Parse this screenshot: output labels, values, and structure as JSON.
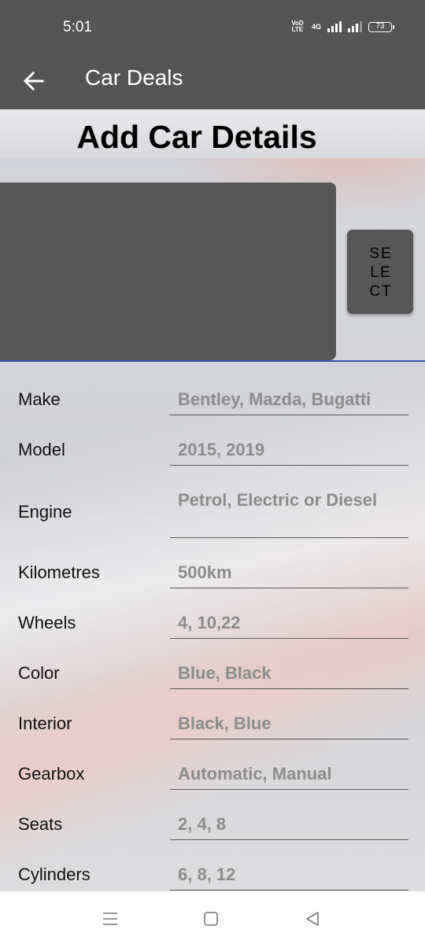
{
  "status_bar": {
    "time": "5:01",
    "volte_label": "VoD LTE",
    "network_label": "4G",
    "battery": "73"
  },
  "app_bar": {
    "title": "Car Deals",
    "back_icon": "arrow-left-icon"
  },
  "page": {
    "title": "Add Car Details",
    "select_button_label": "SELECT"
  },
  "form": {
    "fields": [
      {
        "label": "Make",
        "placeholder": "Bentley, Mazda, Bugatti"
      },
      {
        "label": "Model",
        "placeholder": "2015, 2019"
      },
      {
        "label": "Engine",
        "placeholder": "Petrol, Electric or Diesel"
      },
      {
        "label": "Kilometres",
        "placeholder": "500km"
      },
      {
        "label": "Wheels",
        "placeholder": "4, 10,22"
      },
      {
        "label": "Color",
        "placeholder": "Blue, Black"
      },
      {
        "label": "Interior",
        "placeholder": "Black, Blue"
      },
      {
        "label": "Gearbox",
        "placeholder": "Automatic, Manual"
      },
      {
        "label": "Seats",
        "placeholder": "2, 4, 8"
      },
      {
        "label": "Cylinders",
        "placeholder": "6, 8, 12"
      }
    ]
  },
  "nav_bar": {
    "icons": [
      "menu-icon",
      "home-square-icon",
      "back-triangle-icon"
    ]
  },
  "colors": {
    "app_bar": "#555555",
    "divider_accent": "#3f51b5",
    "placeholder_text": "#8c8c8c"
  }
}
